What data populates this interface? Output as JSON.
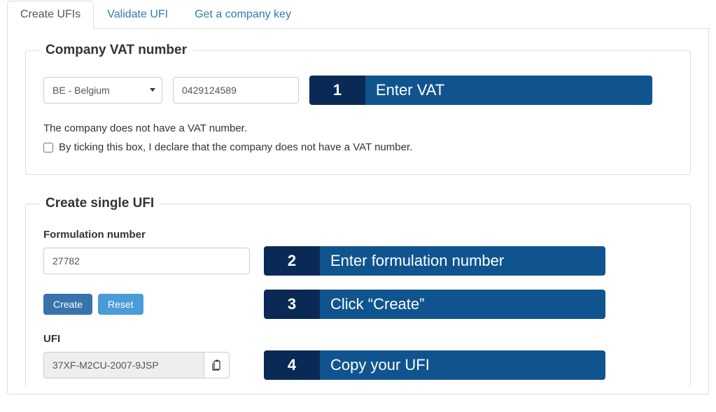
{
  "tabs": [
    {
      "label": "Create UFIs",
      "active": true
    },
    {
      "label": "Validate UFI",
      "active": false
    },
    {
      "label": "Get a company key",
      "active": false
    }
  ],
  "vat_section": {
    "legend": "Company VAT number",
    "country_selected": "BE - Belgium",
    "vat_value": "0429124589",
    "info": "The company does not have a VAT number.",
    "checkbox_label": "By ticking this box, I declare that the company does not have a VAT number."
  },
  "create_section": {
    "legend": "Create single UFI",
    "formulation_label": "Formulation number",
    "formulation_value": "27782",
    "create_btn": "Create",
    "reset_btn": "Reset",
    "ufi_label": "UFI",
    "ufi_value": "37XF-M2CU-2007-9JSP"
  },
  "callouts": [
    {
      "num": "1",
      "text": "Enter VAT"
    },
    {
      "num": "2",
      "text": "Enter formulation number"
    },
    {
      "num": "3",
      "text": "Click “Create”"
    },
    {
      "num": "4",
      "text": "Copy your UFI"
    }
  ]
}
